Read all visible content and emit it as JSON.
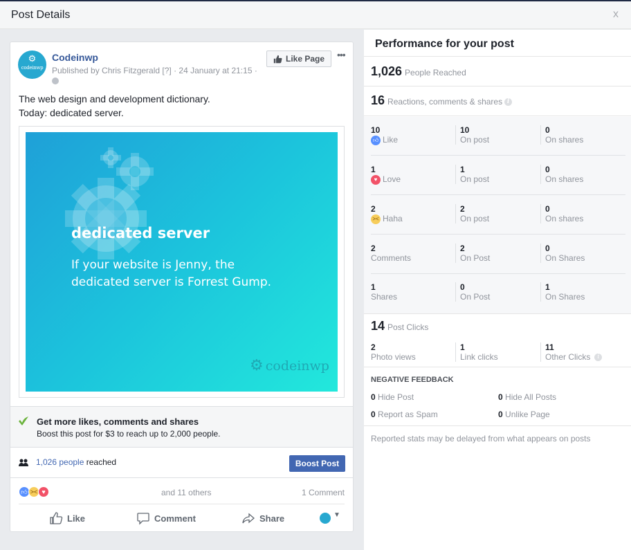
{
  "dialog": {
    "title": "Post Details",
    "close_label": "x"
  },
  "post": {
    "page_name": "Codeinwp",
    "avatar_label": "codeinwp",
    "meta": "Published by Chris Fitzgerald [?] · 24 January at 21:15 ·",
    "like_page_label": "Like Page",
    "more_label": "•••",
    "text_line1": "The web design and development dictionary.",
    "text_line2": "Today: dedicated server.",
    "image": {
      "headline": "dedicated server",
      "line1": "If your website is Jenny, the",
      "line2": "dedicated server is Forrest Gump.",
      "brand": "codeinwp",
      "colors": {
        "start": "#1fa0d8",
        "end": "#22e8dc"
      }
    },
    "boost": {
      "title": "Get more likes, comments and shares",
      "subtitle": "Boost this post for $3 to reach up to 2,000 people.",
      "button_label": "Boost Post"
    },
    "reach": {
      "link_text": "1,026 people",
      "suffix": " reached"
    },
    "reactions_summary": {
      "others": "and 11 others",
      "comments": "1 Comment"
    },
    "actions": {
      "like": "Like",
      "comment": "Comment",
      "share": "Share"
    }
  },
  "performance": {
    "title": "Performance for your post",
    "people_reached": {
      "value": "1,026",
      "label": "People Reached"
    },
    "engagement": {
      "value": "16",
      "label": "Reactions, comments & shares"
    },
    "rows": [
      {
        "total": "10",
        "label": "Like",
        "icon": "like",
        "c2_value": "10",
        "c2_label": "On post",
        "c3_value": "0",
        "c3_label": "On shares"
      },
      {
        "total": "1",
        "label": "Love",
        "icon": "love",
        "c2_value": "1",
        "c2_label": "On post",
        "c3_value": "0",
        "c3_label": "On shares"
      },
      {
        "total": "2",
        "label": "Haha",
        "icon": "haha",
        "c2_value": "2",
        "c2_label": "On post",
        "c3_value": "0",
        "c3_label": "On shares"
      },
      {
        "total": "2",
        "label": "Comments",
        "icon": "",
        "c2_value": "2",
        "c2_label": "On Post",
        "c3_value": "0",
        "c3_label": "On Shares"
      },
      {
        "total": "1",
        "label": "Shares",
        "icon": "",
        "c2_value": "0",
        "c2_label": "On Post",
        "c3_value": "1",
        "c3_label": "On Shares"
      }
    ],
    "post_clicks": {
      "value": "14",
      "label": "Post Clicks",
      "photo_views": {
        "value": "2",
        "label": "Photo views"
      },
      "link_clicks": {
        "value": "1",
        "label": "Link clicks"
      },
      "other_clicks": {
        "value": "11",
        "label": "Other Clicks"
      }
    },
    "negative_feedback": {
      "title": "NEGATIVE FEEDBACK",
      "hide_post": {
        "value": "0",
        "label": " Hide Post"
      },
      "hide_all_posts": {
        "value": "0",
        "label": " Hide All Posts"
      },
      "report_spam": {
        "value": "0",
        "label": " Report as Spam"
      },
      "unlike_page": {
        "value": "0",
        "label": " Unlike Page"
      }
    },
    "note": "Reported stats may be delayed from what appears on posts"
  },
  "colors": {
    "link": "#4267b2",
    "page_name": "#365899",
    "like_blue": "#5890ff",
    "love_red": "#f25268",
    "haha_yellow": "#f7cd5b"
  }
}
